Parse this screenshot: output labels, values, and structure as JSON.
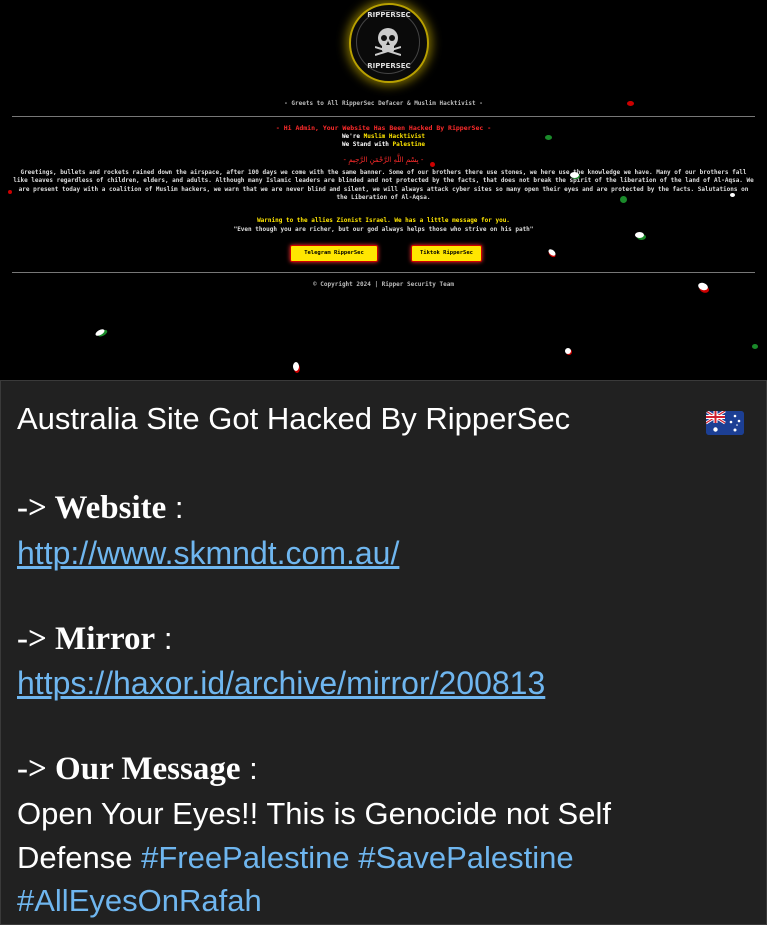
{
  "deface": {
    "logo_top_text": "RIPPERSEC",
    "logo_bottom_text": "RIPPERSEC",
    "greets": "- Greets to All RipperSec Defacer & Muslim Hacktivist -",
    "hacked_line": "- Hi Admin, Your Website Has Been Hacked By RipperSec -",
    "we_prefix_1": "We're ",
    "we_hl_1": "Muslim Hacktivist",
    "we_prefix_2": "We Stand with ",
    "we_hl_2": "Palestine",
    "bismillah": "- بِسْمِ اللَّهِ الرَّحْمَنِ الرَّحِيمِ -",
    "paragraph": "Greetings, bullets and rockets rained down the airspace, after 100 days we come with the same banner. Some of our brothers there use stones, we here use the knowledge we have. Many of our brothers fall like leaves regardless of children, elders, and adults. Although many Islamic leaders are blinded and not protected by the facts, that does not break the spirit of the liberation of the land of Al-Aqsa. We are present today with a coalition of Muslim hackers, we warn that we are never blind and silent, we will always attack cyber sites so many open their eyes and are protected by the facts. Salutations on the Liberation of Al-Aqsa.",
    "warning": "Warning to the allies Zionist Israel. We has a little message for you.",
    "quote": "\"Even though you are richer, but our god always helps those who strive on his path\"",
    "button_telegram": "Telegram RipperSec",
    "button_tiktok": "Tiktok RipperSec",
    "copyright": "© Copyright 2024 | Ripper Security Team"
  },
  "message": {
    "title": "Australia  Site Got Hacked By RipperSec",
    "flag_icon": "australia-flag-icon",
    "website_label": "-> Website",
    "website_colon": " :",
    "website_url": "http://www.skmndt.com.au/",
    "mirror_label": "-> Mirror",
    "mirror_colon": " :",
    "mirror_url": "https://haxor.id/archive/mirror/200813",
    "msg_label": "-> Our Message",
    "msg_colon": " :",
    "msg_line1": " Open Your Eyes!! This is Genocide not Self",
    "msg_line2": "Defense  ",
    "hashtag1": "#FreePalestine",
    "hashtag2": "#SavePalestine",
    "hashtag3": "#AllEyesOnRafah"
  },
  "colors": {
    "link": "#6fb6ef",
    "card_bg": "#212121",
    "deface_red": "#ff2b2b",
    "deface_yellow": "#ffe600"
  }
}
